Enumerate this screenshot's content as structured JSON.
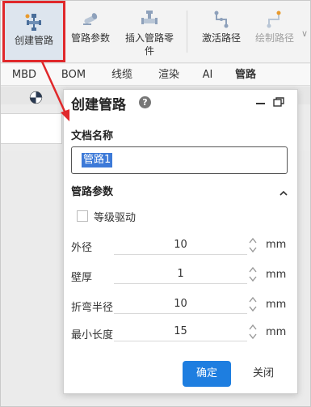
{
  "ribbon": {
    "buttons": [
      {
        "label": "创建管路",
        "icon": "create-pipe-icon"
      },
      {
        "label": "管路参数",
        "icon": "pipe-params-icon"
      },
      {
        "label_line1": "插入管路零",
        "label_line2": "件",
        "icon": "insert-pipe-part-icon"
      },
      {
        "label": "激活路径",
        "icon": "activate-path-icon"
      },
      {
        "label": "绘制路径",
        "icon": "draw-path-icon"
      }
    ]
  },
  "tabs": [
    "MBD",
    "BOM",
    "线缆",
    "渲染",
    "AI",
    "管路"
  ],
  "active_tab": "管路",
  "dialog": {
    "title": "创建管路",
    "doc_name_label": "文档名称",
    "doc_name_value": "管路1",
    "pipe_params_label": "管路参数",
    "grade_drive_label": "等级驱动",
    "grade_drive_checked": false,
    "params": [
      {
        "label": "外径",
        "value": "10",
        "unit": "mm"
      },
      {
        "label": "壁厚",
        "value": "1",
        "unit": "mm"
      },
      {
        "label": "折弯半径",
        "value": "10",
        "unit": "mm"
      },
      {
        "label": "最小长度",
        "value": "15",
        "unit": "mm"
      }
    ],
    "ok_label": "确定",
    "close_label": "关闭"
  },
  "colors": {
    "accent": "#1e7ee0",
    "highlight_border": "#e0282b",
    "selection": "#3d7ad8"
  }
}
